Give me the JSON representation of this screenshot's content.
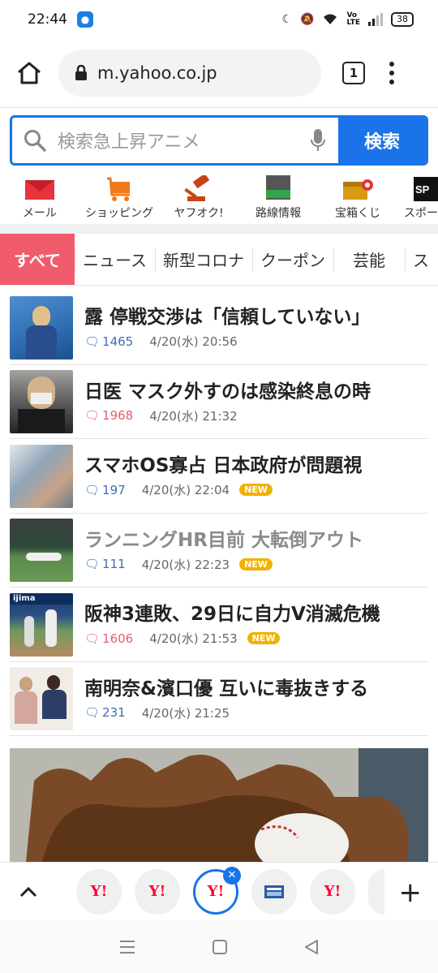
{
  "status": {
    "time": "22:44",
    "battery": "38",
    "app_icon": "android-icon"
  },
  "browser": {
    "url": "m.yahoo.co.jp",
    "tab_count": "1"
  },
  "search": {
    "placeholder": "検索急上昇アニメ",
    "button": "検索"
  },
  "services": [
    {
      "label": "メール",
      "icon": "mail-icon"
    },
    {
      "label": "ショッピング",
      "icon": "cart-icon"
    },
    {
      "label": "ヤフオク!",
      "icon": "gavel-icon"
    },
    {
      "label": "路線情報",
      "icon": "train-icon"
    },
    {
      "label": "宝箱くじ",
      "icon": "treasure-icon"
    },
    {
      "label": "スポーツ",
      "icon": "sports-icon"
    }
  ],
  "categories": [
    "すべて",
    "ニュース",
    "新型コロナ",
    "クーポン",
    "芸能",
    "ス"
  ],
  "news": [
    {
      "title": "露 停戦交渉は「信頼していない」",
      "comments": "1465",
      "date": "4/20(水) 20:56",
      "new": "",
      "visited": false,
      "hot": false
    },
    {
      "title": "日医 マスク外すのは感染終息の時",
      "comments": "1968",
      "date": "4/20(水) 21:32",
      "new": "",
      "visited": false,
      "hot": true
    },
    {
      "title": "スマホOS寡占 日本政府が問題視",
      "comments": "197",
      "date": "4/20(水) 22:04",
      "new": "NEW",
      "visited": false,
      "hot": false
    },
    {
      "title": "ランニングHR目前 大転倒アウト",
      "comments": "111",
      "date": "4/20(水) 22:23",
      "new": "NEW",
      "visited": true,
      "hot": false
    },
    {
      "title": "阪神3連敗、29日に自力V消滅危機",
      "comments": "1606",
      "date": "4/20(水) 21:53",
      "new": "NEW",
      "visited": false,
      "hot": true
    },
    {
      "title": "南明奈&濱口優 互いに毒抜きする",
      "comments": "231",
      "date": "4/20(水) 21:25",
      "new": "",
      "visited": false,
      "hot": false
    }
  ],
  "tabstrip": {
    "tab_logo": "Y!",
    "colors": {
      "accent": "#1a73e8",
      "yahoo_red": "#ff0033",
      "category_active": "#f15c6d",
      "new_badge": "#f2b100"
    }
  }
}
